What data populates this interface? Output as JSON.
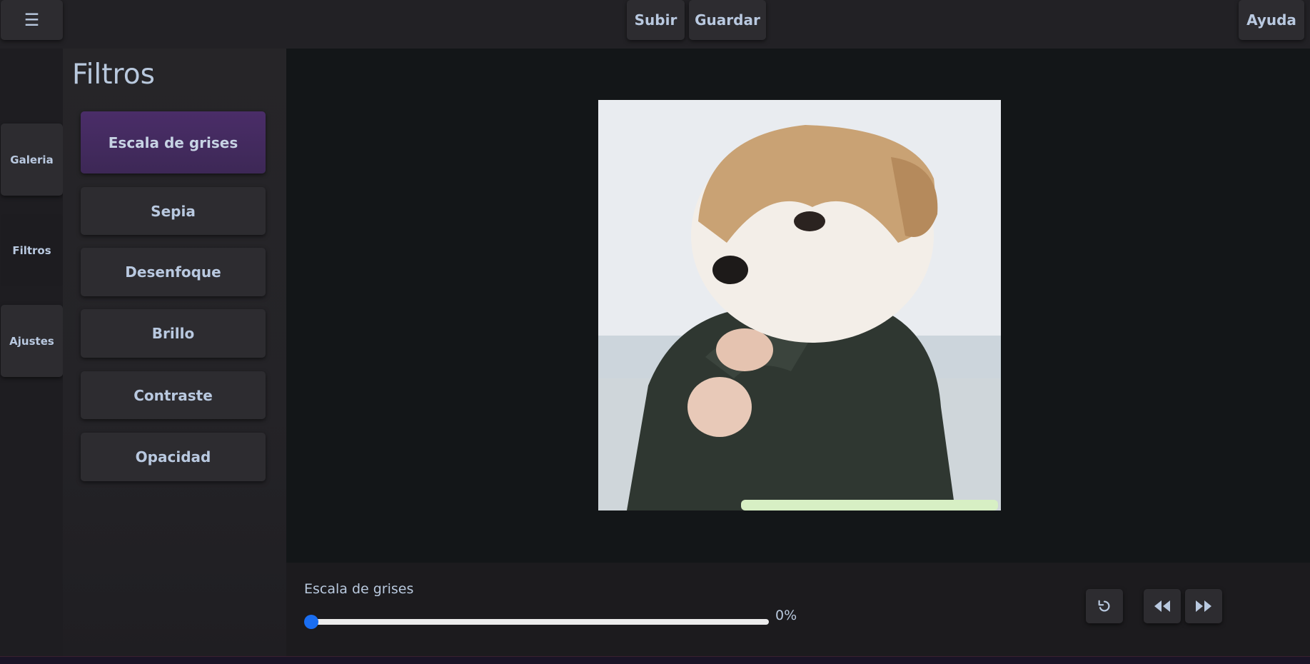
{
  "topbar": {
    "menu_icon": "☰",
    "upload_label": "Subir",
    "save_label": "Guardar",
    "help_label": "Ayuda"
  },
  "rail": {
    "items": [
      {
        "label": "Galeria"
      },
      {
        "label": "Filtros"
      },
      {
        "label": "Ajustes"
      }
    ]
  },
  "panel": {
    "title": "Filtros",
    "filters": [
      {
        "label": "Escala de grises",
        "active": true
      },
      {
        "label": "Sepia"
      },
      {
        "label": "Desenfoque"
      },
      {
        "label": "Brillo"
      },
      {
        "label": "Contraste"
      },
      {
        "label": "Opacidad"
      }
    ]
  },
  "controls": {
    "label": "Escala de grises",
    "value": 0,
    "value_text": "0%"
  },
  "icons": {
    "reset": "undo-icon",
    "rewind": "rewind-icon",
    "forward": "fast-forward-icon"
  },
  "colors": {
    "accent": "#1a6ef2",
    "active_filter": "#4a2d68",
    "background": "#1c1b1f"
  }
}
